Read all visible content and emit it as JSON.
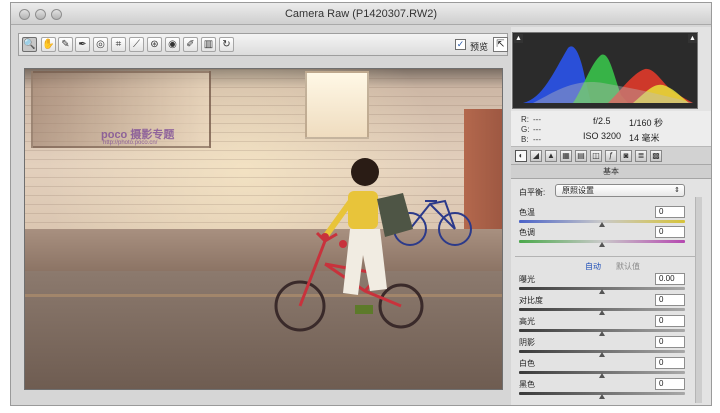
{
  "window": {
    "title": "Camera Raw (P1420307.RW2)"
  },
  "toolbar": {
    "tools": [
      {
        "name": "zoom-tool-icon",
        "glyph": "🔍"
      },
      {
        "name": "hand-tool-icon",
        "glyph": "✋"
      },
      {
        "name": "white-balance-tool-icon",
        "glyph": "✎"
      },
      {
        "name": "color-sampler-tool-icon",
        "glyph": "✒"
      },
      {
        "name": "target-adjustment-tool-icon",
        "glyph": "◎"
      },
      {
        "name": "crop-tool-icon",
        "glyph": "⌗"
      },
      {
        "name": "straighten-tool-icon",
        "glyph": "⟋"
      },
      {
        "name": "spot-removal-tool-icon",
        "glyph": "⊛"
      },
      {
        "name": "red-eye-tool-icon",
        "glyph": "◉"
      },
      {
        "name": "adjustment-brush-icon",
        "glyph": "✐"
      },
      {
        "name": "graduated-filter-icon",
        "glyph": "▥"
      },
      {
        "name": "rotate-icon",
        "glyph": "↻"
      }
    ],
    "preview_checked": "✓",
    "preview_label": "预览",
    "fullscreen_glyph": "⇱"
  },
  "photo": {
    "watermark": "poco 摄影专题",
    "watermark_url": "http://photo.poco.cn/"
  },
  "histogram": {
    "clip_left": "▲",
    "clip_right": "▲"
  },
  "readout": {
    "r_label": "R:",
    "r_value": "---",
    "g_label": "G:",
    "g_value": "---",
    "b_label": "B:",
    "b_value": "---",
    "aperture": "f/2.5",
    "shutter": "1/160 秒",
    "iso": "ISO 3200",
    "focal": "14 毫米"
  },
  "panel": {
    "header": "基本",
    "tabs": [
      {
        "name": "basic-tab-icon",
        "glyph": "◐"
      },
      {
        "name": "tone-curve-tab-icon",
        "glyph": "◢"
      },
      {
        "name": "detail-tab-icon",
        "glyph": "▲"
      },
      {
        "name": "hsl-tab-icon",
        "glyph": "▦"
      },
      {
        "name": "split-toning-tab-icon",
        "glyph": "▤"
      },
      {
        "name": "lens-corrections-tab-icon",
        "glyph": "◫"
      },
      {
        "name": "effects-tab-icon",
        "glyph": "ƒ"
      },
      {
        "name": "camera-calibration-tab-icon",
        "glyph": "◙"
      },
      {
        "name": "presets-tab-icon",
        "glyph": "≣"
      },
      {
        "name": "snapshots-tab-icon",
        "glyph": "▩"
      }
    ],
    "wb_label": "白平衡:",
    "wb_value": "原照设置",
    "auto_label": "自动",
    "default_label": "默认值",
    "sliders": [
      {
        "name": "temperature",
        "label": "色温",
        "value": "0",
        "position": 0.5
      },
      {
        "name": "tint",
        "label": "色调",
        "value": "0",
        "position": 0.5
      },
      {
        "name": "exposure",
        "label": "曝光",
        "value": "0.00",
        "position": 0.5
      },
      {
        "name": "contrast",
        "label": "对比度",
        "value": "0",
        "position": 0.5
      },
      {
        "name": "highlights",
        "label": "高光",
        "value": "0",
        "position": 0.5
      },
      {
        "name": "shadows",
        "label": "阴影",
        "value": "0",
        "position": 0.5
      },
      {
        "name": "whites",
        "label": "白色",
        "value": "0",
        "position": 0.5
      },
      {
        "name": "blacks",
        "label": "黑色",
        "value": "0",
        "position": 0.5
      }
    ]
  }
}
